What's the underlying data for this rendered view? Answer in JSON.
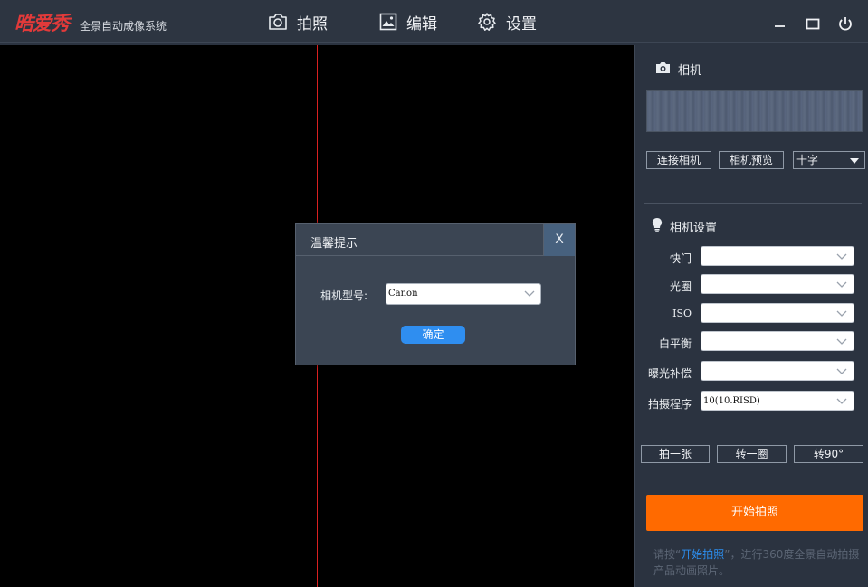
{
  "app": {
    "logo": "晧爱秀",
    "subtitle": "全景自动成像系统"
  },
  "nav": [
    {
      "label": "拍照",
      "icon": "camera-icon"
    },
    {
      "label": "编辑",
      "icon": "image-edit-icon"
    },
    {
      "label": "设置",
      "icon": "gear-icon"
    }
  ],
  "window_controls": [
    "minimize-icon",
    "maximize-icon",
    "power-icon"
  ],
  "dialog": {
    "title": "温馨提示",
    "close": "X",
    "label": "相机型号:",
    "value": "Canon",
    "ok": "确定"
  },
  "camera": {
    "title": "相机",
    "connect": "连接相机",
    "preview": "相机预览",
    "mode": "十字"
  },
  "settings": {
    "title": "相机设置",
    "rows": [
      {
        "label": "快门",
        "value": ""
      },
      {
        "label": "光圈",
        "value": ""
      },
      {
        "label": "ISO",
        "value": ""
      },
      {
        "label": "白平衡",
        "value": ""
      },
      {
        "label": "曝光补偿",
        "value": ""
      },
      {
        "label": "拍摄程序",
        "value": "10(10.RISD)"
      }
    ]
  },
  "actions": {
    "shoot_one": "拍一张",
    "rotate_once": "转一圈",
    "rotate_90": "转90°"
  },
  "start": "开始拍照",
  "hint": {
    "pre": "请按“",
    "highlight": "开始拍照",
    "post": "”，进行360度全景自动拍摄产品动画照片。"
  },
  "colors": {
    "accent": "#ff6a00",
    "crosshair": "#d92020",
    "primary_button": "#2f8ef0",
    "logo": "#e23a3a"
  }
}
